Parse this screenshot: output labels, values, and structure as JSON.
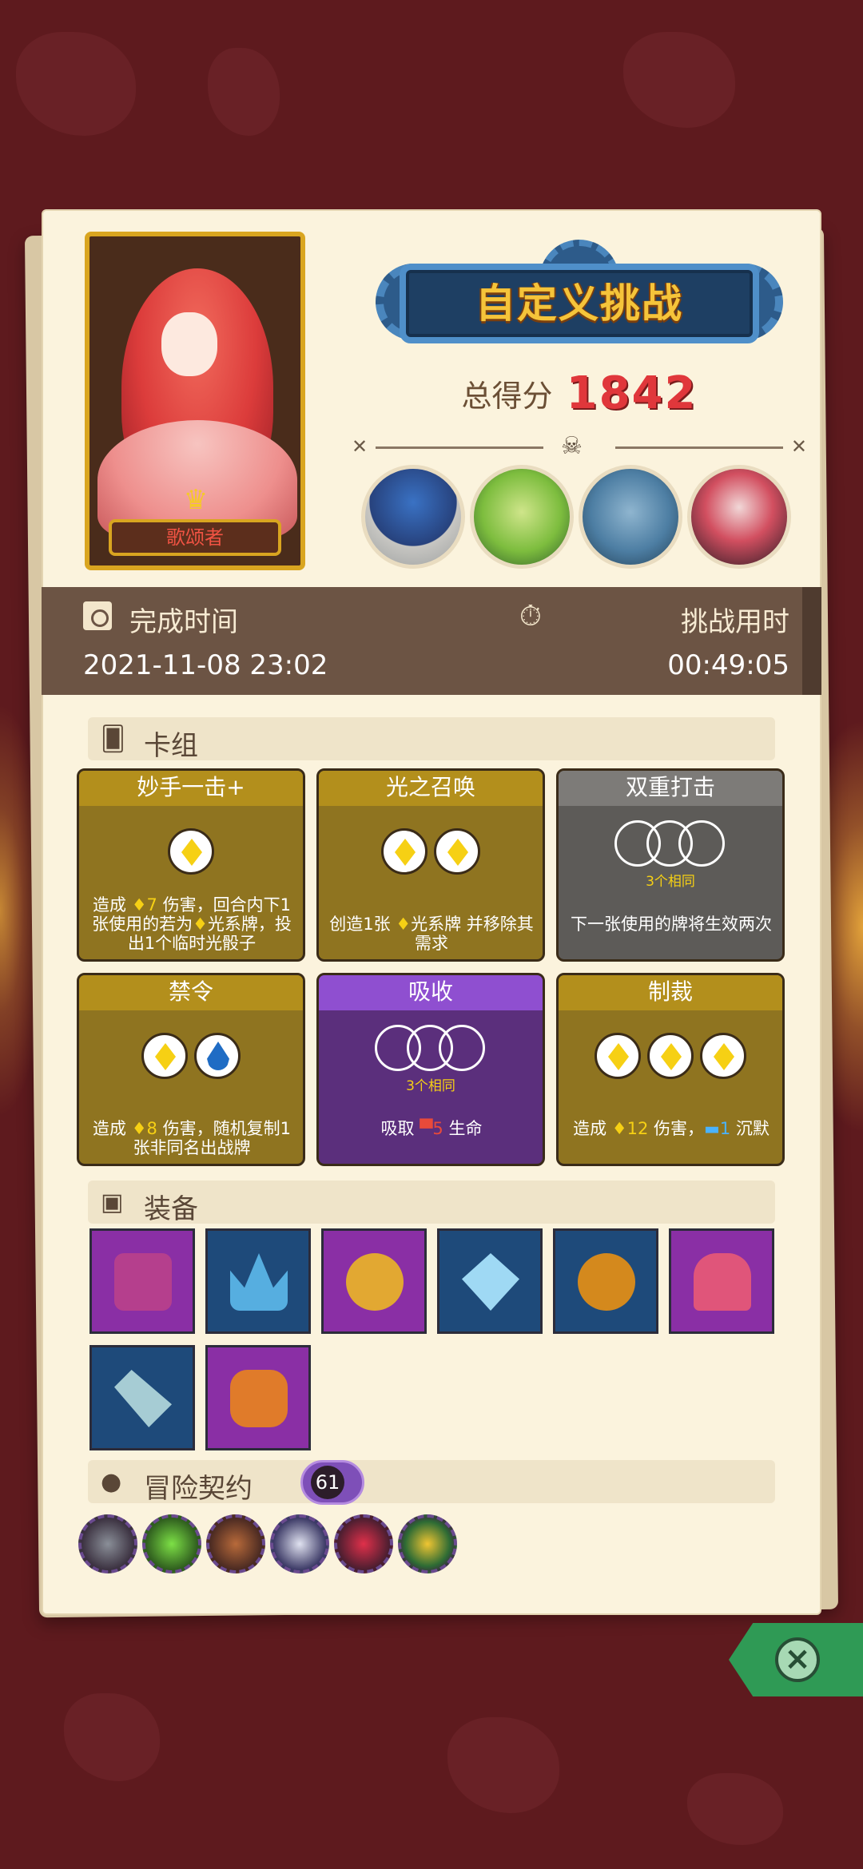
{
  "hero": {
    "name": "歌颂者"
  },
  "banner": {
    "title": "自定义挑战"
  },
  "score": {
    "label": "总得分",
    "value": "1842"
  },
  "time": {
    "finish_label": "完成时间",
    "finish_value": "2021-11-08 23:02",
    "duration_label": "挑战用时",
    "duration_value": "00:49:05"
  },
  "deck": {
    "title": "卡组",
    "cards": [
      {
        "name": "妙手一击+",
        "color": "gold",
        "slots": [
          "light"
        ],
        "desc_a": "造成 ",
        "desc_num": "7",
        "desc_b": " 伤害，回合内下1张使用的若为",
        "desc_c": "光系牌，投出1个临时光骰子"
      },
      {
        "name": "光之召唤",
        "color": "gold",
        "slots": [
          "light",
          "light"
        ],
        "desc_a": "创造1张 ",
        "desc_b": "光系牌 并移除其需求"
      },
      {
        "name": "双重打击",
        "color": "gray",
        "same": "3个相同",
        "desc_a": "下一张使用的牌将生效两次"
      },
      {
        "name": "禁令",
        "color": "gold",
        "slots": [
          "light",
          "water"
        ],
        "desc_a": "造成 ",
        "desc_num": "8",
        "desc_b": " 伤害，随机复制1张非同名出战牌"
      },
      {
        "name": "吸收",
        "color": "purple",
        "same": "3个相同",
        "desc_a": "吸取 ",
        "desc_num": "5",
        "desc_b": " 生命"
      },
      {
        "name": "制裁",
        "color": "gold",
        "slots": [
          "light",
          "light",
          "light"
        ],
        "desc_a": "造成 ",
        "desc_num": "12",
        "desc_b": " 伤害，",
        "desc_num2": "1",
        "desc_c": " 沉默"
      }
    ]
  },
  "equipment": {
    "title": "装备",
    "items": [
      {
        "name": "armor",
        "bg": "purple"
      },
      {
        "name": "ice-crown",
        "bg": "blue"
      },
      {
        "name": "ring",
        "bg": "purple"
      },
      {
        "name": "diamond",
        "bg": "blue"
      },
      {
        "name": "fruit",
        "bg": "blue"
      },
      {
        "name": "flesh",
        "bg": "purple"
      },
      {
        "name": "blade",
        "bg": "blue"
      },
      {
        "name": "bracer",
        "bg": "purple"
      }
    ]
  },
  "contracts": {
    "title": "冒险契约",
    "count": "61",
    "medals": [
      "helmet",
      "poison",
      "crate",
      "fist",
      "heart-lock",
      "star"
    ]
  },
  "colors": {
    "gold": "#8f7420",
    "purple": "#5b2f7c",
    "gray": "#5d5b58",
    "score": "#e0373b"
  }
}
